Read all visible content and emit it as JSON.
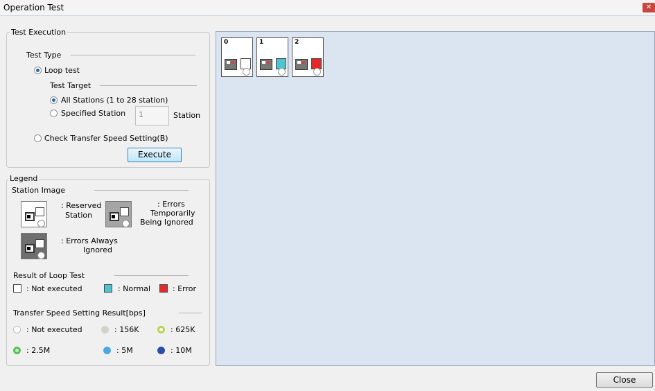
{
  "window": {
    "title": "Operation Test",
    "close_glyph": "✕"
  },
  "test_execution": {
    "group_title": "Test Execution",
    "test_type_label": "Test Type",
    "loop_test_label": "Loop test",
    "test_target_label": "Test Target",
    "all_stations_label": "All Stations (1 to 28 station)",
    "specified_station_label": "Specified Station",
    "station_value": "1",
    "station_suffix": "Station",
    "check_transfer_label": "Check Transfer Speed Setting(B)",
    "execute_label": "Execute"
  },
  "legend": {
    "group_title": "Legend",
    "station_image_label": "Station Image",
    "reserved_line1": ": Reserved",
    "reserved_line2": "Station",
    "temp_line1": ": Errors",
    "temp_line2": "Temporarily",
    "temp_line3": "Being Ignored",
    "always_line1": ": Errors Always",
    "always_line2": "Ignored",
    "loop_result_label": "Result of Loop Test",
    "not_executed": ": Not executed",
    "normal": ": Normal",
    "error": ": Error",
    "transfer_label": "Transfer Speed Setting Result[bps]",
    "speeds": [
      ": Not executed",
      ": 156K",
      ": 625K",
      ": 2.5M",
      ": 5M",
      ": 10M"
    ]
  },
  "stations": [
    {
      "number": "0",
      "result_color": "#ffffff"
    },
    {
      "number": "1",
      "result_color": "#4fc3cf"
    },
    {
      "number": "2",
      "result_color": "#e82828"
    }
  ],
  "colors": {
    "normal": "#4fc3cf",
    "error": "#e82828",
    "panel_bg": "#dbe4f1"
  },
  "footer": {
    "close_label": "Close"
  }
}
